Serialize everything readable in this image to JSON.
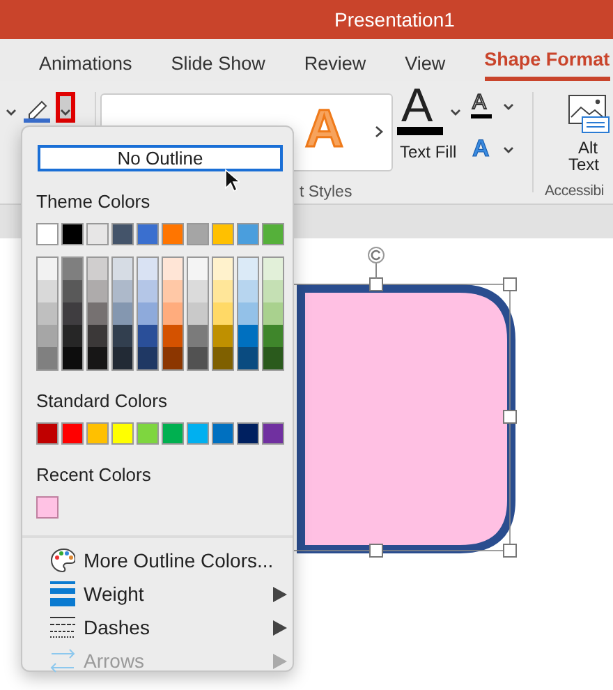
{
  "window": {
    "title": "Presentation1"
  },
  "tabs": [
    {
      "label": "Animations",
      "selected": false
    },
    {
      "label": "Slide Show",
      "selected": false
    },
    {
      "label": "Review",
      "selected": false
    },
    {
      "label": "View",
      "selected": false
    },
    {
      "label": "Shape Format",
      "selected": true
    }
  ],
  "ribbon": {
    "outline_dropdown_open": true,
    "gallery": [
      {
        "glyph": "A",
        "color": "#f7a35c"
      }
    ],
    "text_fill": {
      "glyph": "A",
      "label": "Text Fill"
    },
    "text_outline": {
      "glyph": "A"
    },
    "text_effects": {
      "glyph": "A"
    },
    "alt_text": {
      "label_lines": [
        "Alt",
        "Text"
      ]
    },
    "group_labels": [
      "t Styles",
      "Accessibi"
    ]
  },
  "menu": {
    "no_outline": {
      "label": "No Outline",
      "selected": true
    },
    "theme_label": "Theme Colors",
    "theme_colors": [
      {
        "color": "#ffffff",
        "shades": [
          {
            "color": "#f2f2f2"
          },
          {
            "color": "#d9d9d9"
          },
          {
            "color": "#bfbfbf"
          },
          {
            "color": "#a6a6a6"
          },
          {
            "color": "#808080"
          }
        ]
      },
      {
        "color": "#000000",
        "shades": [
          {
            "color": "#7f7f7f"
          },
          {
            "color": "#595959"
          },
          {
            "color": "#3f3d40"
          },
          {
            "color": "#262626"
          },
          {
            "color": "#0d0d0d"
          }
        ]
      },
      {
        "color": "#e7e6e6",
        "shades": [
          {
            "color": "#d0cece"
          },
          {
            "color": "#aeabab"
          },
          {
            "color": "#767171"
          },
          {
            "color": "#3b3838"
          },
          {
            "color": "#171616"
          }
        ]
      },
      {
        "color": "#44546a",
        "shades": [
          {
            "color": "#d6dce4"
          },
          {
            "color": "#adb9ca"
          },
          {
            "color": "#8497b0"
          },
          {
            "color": "#323f4f"
          },
          {
            "color": "#222a35"
          }
        ]
      },
      {
        "color": "#3a6fcf",
        "shades": [
          {
            "color": "#d9e2f3"
          },
          {
            "color": "#b4c6e7"
          },
          {
            "color": "#8eaadb"
          },
          {
            "color": "#2a4f99"
          },
          {
            "color": "#1f3864"
          }
        ]
      },
      {
        "color": "#ff7500",
        "shades": [
          {
            "color": "#ffe5d6"
          },
          {
            "color": "#ffc8a6"
          },
          {
            "color": "#ffac7d"
          },
          {
            "color": "#d45200"
          },
          {
            "color": "#8c3600"
          }
        ]
      },
      {
        "color": "#a5a5a5",
        "shades": [
          {
            "color": "#f4f4f4"
          },
          {
            "color": "#dbdbdb"
          },
          {
            "color": "#c9c9c9"
          },
          {
            "color": "#7b7b7b"
          },
          {
            "color": "#525252"
          }
        ]
      },
      {
        "color": "#ffc000",
        "shades": [
          {
            "color": "#fff2cc"
          },
          {
            "color": "#ffe699"
          },
          {
            "color": "#ffd966"
          },
          {
            "color": "#bf9000"
          },
          {
            "color": "#7f6000"
          }
        ]
      },
      {
        "color": "#4a9edd",
        "shades": [
          {
            "color": "#dbeaf7"
          },
          {
            "color": "#b7d5ef"
          },
          {
            "color": "#93c1e8"
          },
          {
            "color": "#0070c0"
          },
          {
            "color": "#0a4b80"
          }
        ]
      },
      {
        "color": "#55b03a",
        "shades": [
          {
            "color": "#e2f0d9"
          },
          {
            "color": "#c5e0b4"
          },
          {
            "color": "#a9d18e"
          },
          {
            "color": "#3f862b"
          },
          {
            "color": "#2a5a1c"
          }
        ]
      }
    ],
    "standard_label": "Standard Colors",
    "standard_colors": [
      {
        "color": "#c00000"
      },
      {
        "color": "#ff0000"
      },
      {
        "color": "#ffc000"
      },
      {
        "color": "#ffff00"
      },
      {
        "color": "#7ed63f"
      },
      {
        "color": "#00b050"
      },
      {
        "color": "#00b0f0"
      },
      {
        "color": "#0070c0"
      },
      {
        "color": "#002060"
      },
      {
        "color": "#7030a0"
      }
    ],
    "recent_label": "Recent Colors",
    "recent_colors": [
      {
        "color": "#ffc2e4"
      }
    ],
    "items": [
      {
        "kind": "palette",
        "label": "More Outline Colors...",
        "submenu": false,
        "disabled": false
      },
      {
        "kind": "weight",
        "label": "Weight",
        "submenu": true,
        "disabled": false
      },
      {
        "kind": "dashes",
        "label": "Dashes",
        "submenu": true,
        "disabled": false
      },
      {
        "kind": "arrows",
        "label": "Arrows",
        "submenu": true,
        "disabled": true
      }
    ]
  },
  "shape": {
    "selected": true
  }
}
